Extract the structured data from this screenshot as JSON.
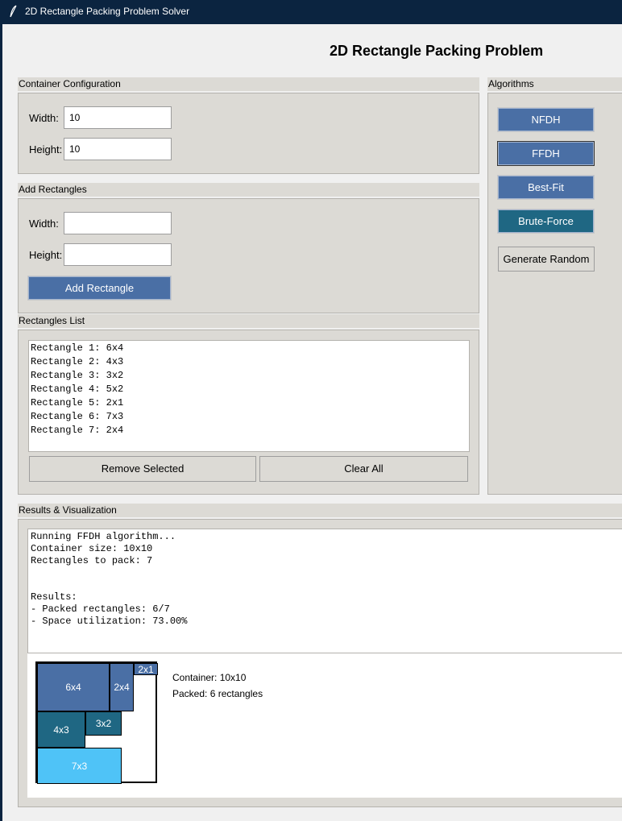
{
  "window": {
    "title": "2D Rectangle Packing Problem Solver"
  },
  "header": {
    "title": "2D Rectangle Packing Problem"
  },
  "container_config": {
    "section_label": "Container Configuration",
    "width_label": "Width:",
    "width_value": "10",
    "height_label": "Height:",
    "height_value": "10"
  },
  "add_rectangles": {
    "section_label": "Add Rectangles",
    "width_label": "Width:",
    "width_value": "",
    "height_label": "Height:",
    "height_value": "",
    "add_button": "Add Rectangle"
  },
  "rectangles_list": {
    "section_label": "Rectangles List",
    "items": [
      "Rectangle 1: 6x4",
      "Rectangle 2: 4x3",
      "Rectangle 3: 3x2",
      "Rectangle 4: 5x2",
      "Rectangle 5: 2x1",
      "Rectangle 6: 7x3",
      "Rectangle 7: 2x4"
    ],
    "remove_button": "Remove Selected",
    "clear_button": "Clear All"
  },
  "algorithms": {
    "section_label": "Algorithms",
    "buttons": [
      "NFDH",
      "FFDH",
      "Best-Fit",
      "Brute-Force"
    ],
    "generate_button": "Generate Random"
  },
  "results": {
    "section_label": "Results & Visualization",
    "log": "Running FFDH algorithm...\nContainer size: 10x10\nRectangles to pack: 7\n\n\nResults:\n- Packed rectangles: 6/7\n- Space utilization: 73.00%",
    "container_info": "Container: 10x10",
    "packed_info": "Packed: 6 rectangles"
  },
  "packing": {
    "container": {
      "w": 10,
      "h": 10
    },
    "placed": [
      {
        "label": "6x4",
        "x": 0,
        "y": 0,
        "w": 6,
        "h": 4,
        "color": "#4a6fa5"
      },
      {
        "label": "2x4",
        "x": 6,
        "y": 0,
        "w": 2,
        "h": 4,
        "color": "#4a6fa5"
      },
      {
        "label": "2x1",
        "x": 8,
        "y": 0,
        "w": 2,
        "h": 1,
        "color": "#4a6fa5"
      },
      {
        "label": "4x3",
        "x": 0,
        "y": 4,
        "w": 4,
        "h": 3,
        "color": "#1f6783"
      },
      {
        "label": "3x2",
        "x": 4,
        "y": 4,
        "w": 3,
        "h": 2,
        "color": "#1f6783"
      },
      {
        "label": "7x3",
        "x": 0,
        "y": 7,
        "w": 7,
        "h": 3,
        "color": "#4fc3f7"
      }
    ]
  }
}
